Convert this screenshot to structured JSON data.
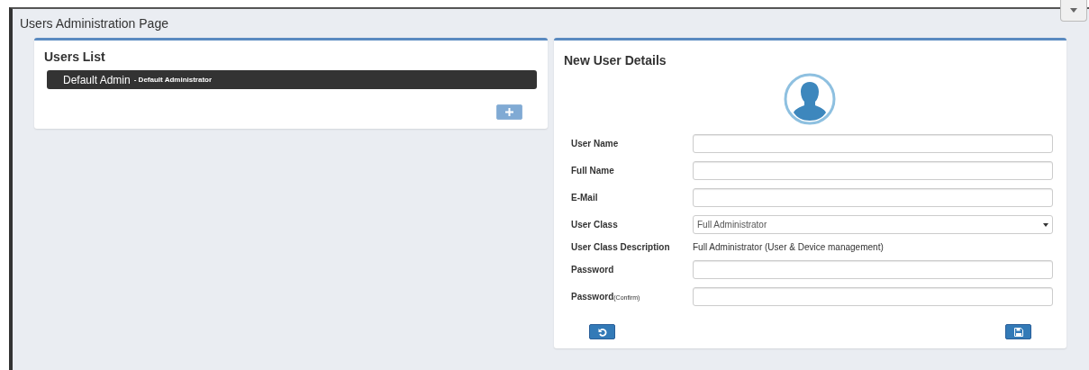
{
  "page_title": "Users Administration Page",
  "users_list": {
    "title": "Users List",
    "users": [
      {
        "name": "Default Admin",
        "role": "- Default Administrator",
        "selected": true
      }
    ],
    "add_button": {
      "disabled": true
    }
  },
  "details": {
    "title": "New User Details",
    "fields": [
      {
        "kind": "input",
        "label": "User Name"
      },
      {
        "kind": "input",
        "label": "Full Name"
      },
      {
        "kind": "input",
        "label": "E-Mail"
      },
      {
        "kind": "select",
        "label": "User Class",
        "value": "Full Administrator"
      },
      {
        "kind": "text",
        "label": "User Class Description",
        "value": "Full Administrator (User & Device management)"
      },
      {
        "kind": "input",
        "label": "Password"
      },
      {
        "kind": "input",
        "label": "Password",
        "note": "(Confirm)"
      }
    ]
  }
}
